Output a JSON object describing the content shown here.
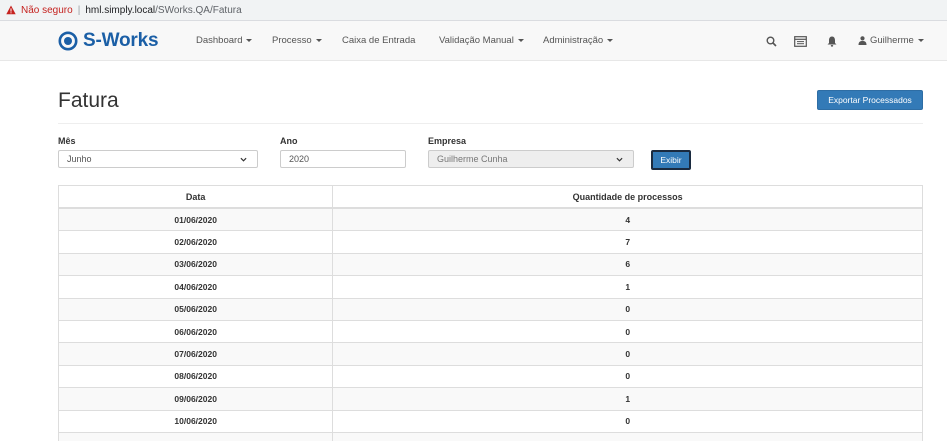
{
  "browser": {
    "insecure_label": "Não seguro",
    "separator": "|",
    "host": "hml.simply.local",
    "path": "/SWorks.QA/Fatura"
  },
  "navbar": {
    "brand": "S-Works",
    "brand_color": "#1b5fa6",
    "items": [
      {
        "label": "Dashboard",
        "dropdown": true
      },
      {
        "label": "Processo",
        "dropdown": true
      },
      {
        "label": "Caixa de Entrada",
        "dropdown": false
      },
      {
        "label": "Validação Manual",
        "dropdown": true
      },
      {
        "label": "Administração",
        "dropdown": true
      }
    ],
    "icons": [
      "search-icon",
      "inbox-icon",
      "bell-icon"
    ],
    "user": "Guilherme"
  },
  "page": {
    "title": "Fatura",
    "export_button": "Exportar Processados"
  },
  "filters": {
    "mes_label": "Mês",
    "mes_value": "Junho",
    "ano_label": "Ano",
    "ano_value": "2020",
    "empresa_label": "Empresa",
    "empresa_value": "Guilherme Cunha",
    "exibir_button": "Exibir"
  },
  "table": {
    "headers": [
      "Data",
      "Quantidade de processos"
    ],
    "rows": [
      [
        "01/06/2020",
        "4"
      ],
      [
        "02/06/2020",
        "7"
      ],
      [
        "03/06/2020",
        "6"
      ],
      [
        "04/06/2020",
        "1"
      ],
      [
        "05/06/2020",
        "0"
      ],
      [
        "06/06/2020",
        "0"
      ],
      [
        "07/06/2020",
        "0"
      ],
      [
        "08/06/2020",
        "0"
      ],
      [
        "09/06/2020",
        "1"
      ],
      [
        "10/06/2020",
        "0"
      ]
    ]
  },
  "colors": {
    "primary": "#337ab7",
    "insecure": "#c5221f"
  }
}
